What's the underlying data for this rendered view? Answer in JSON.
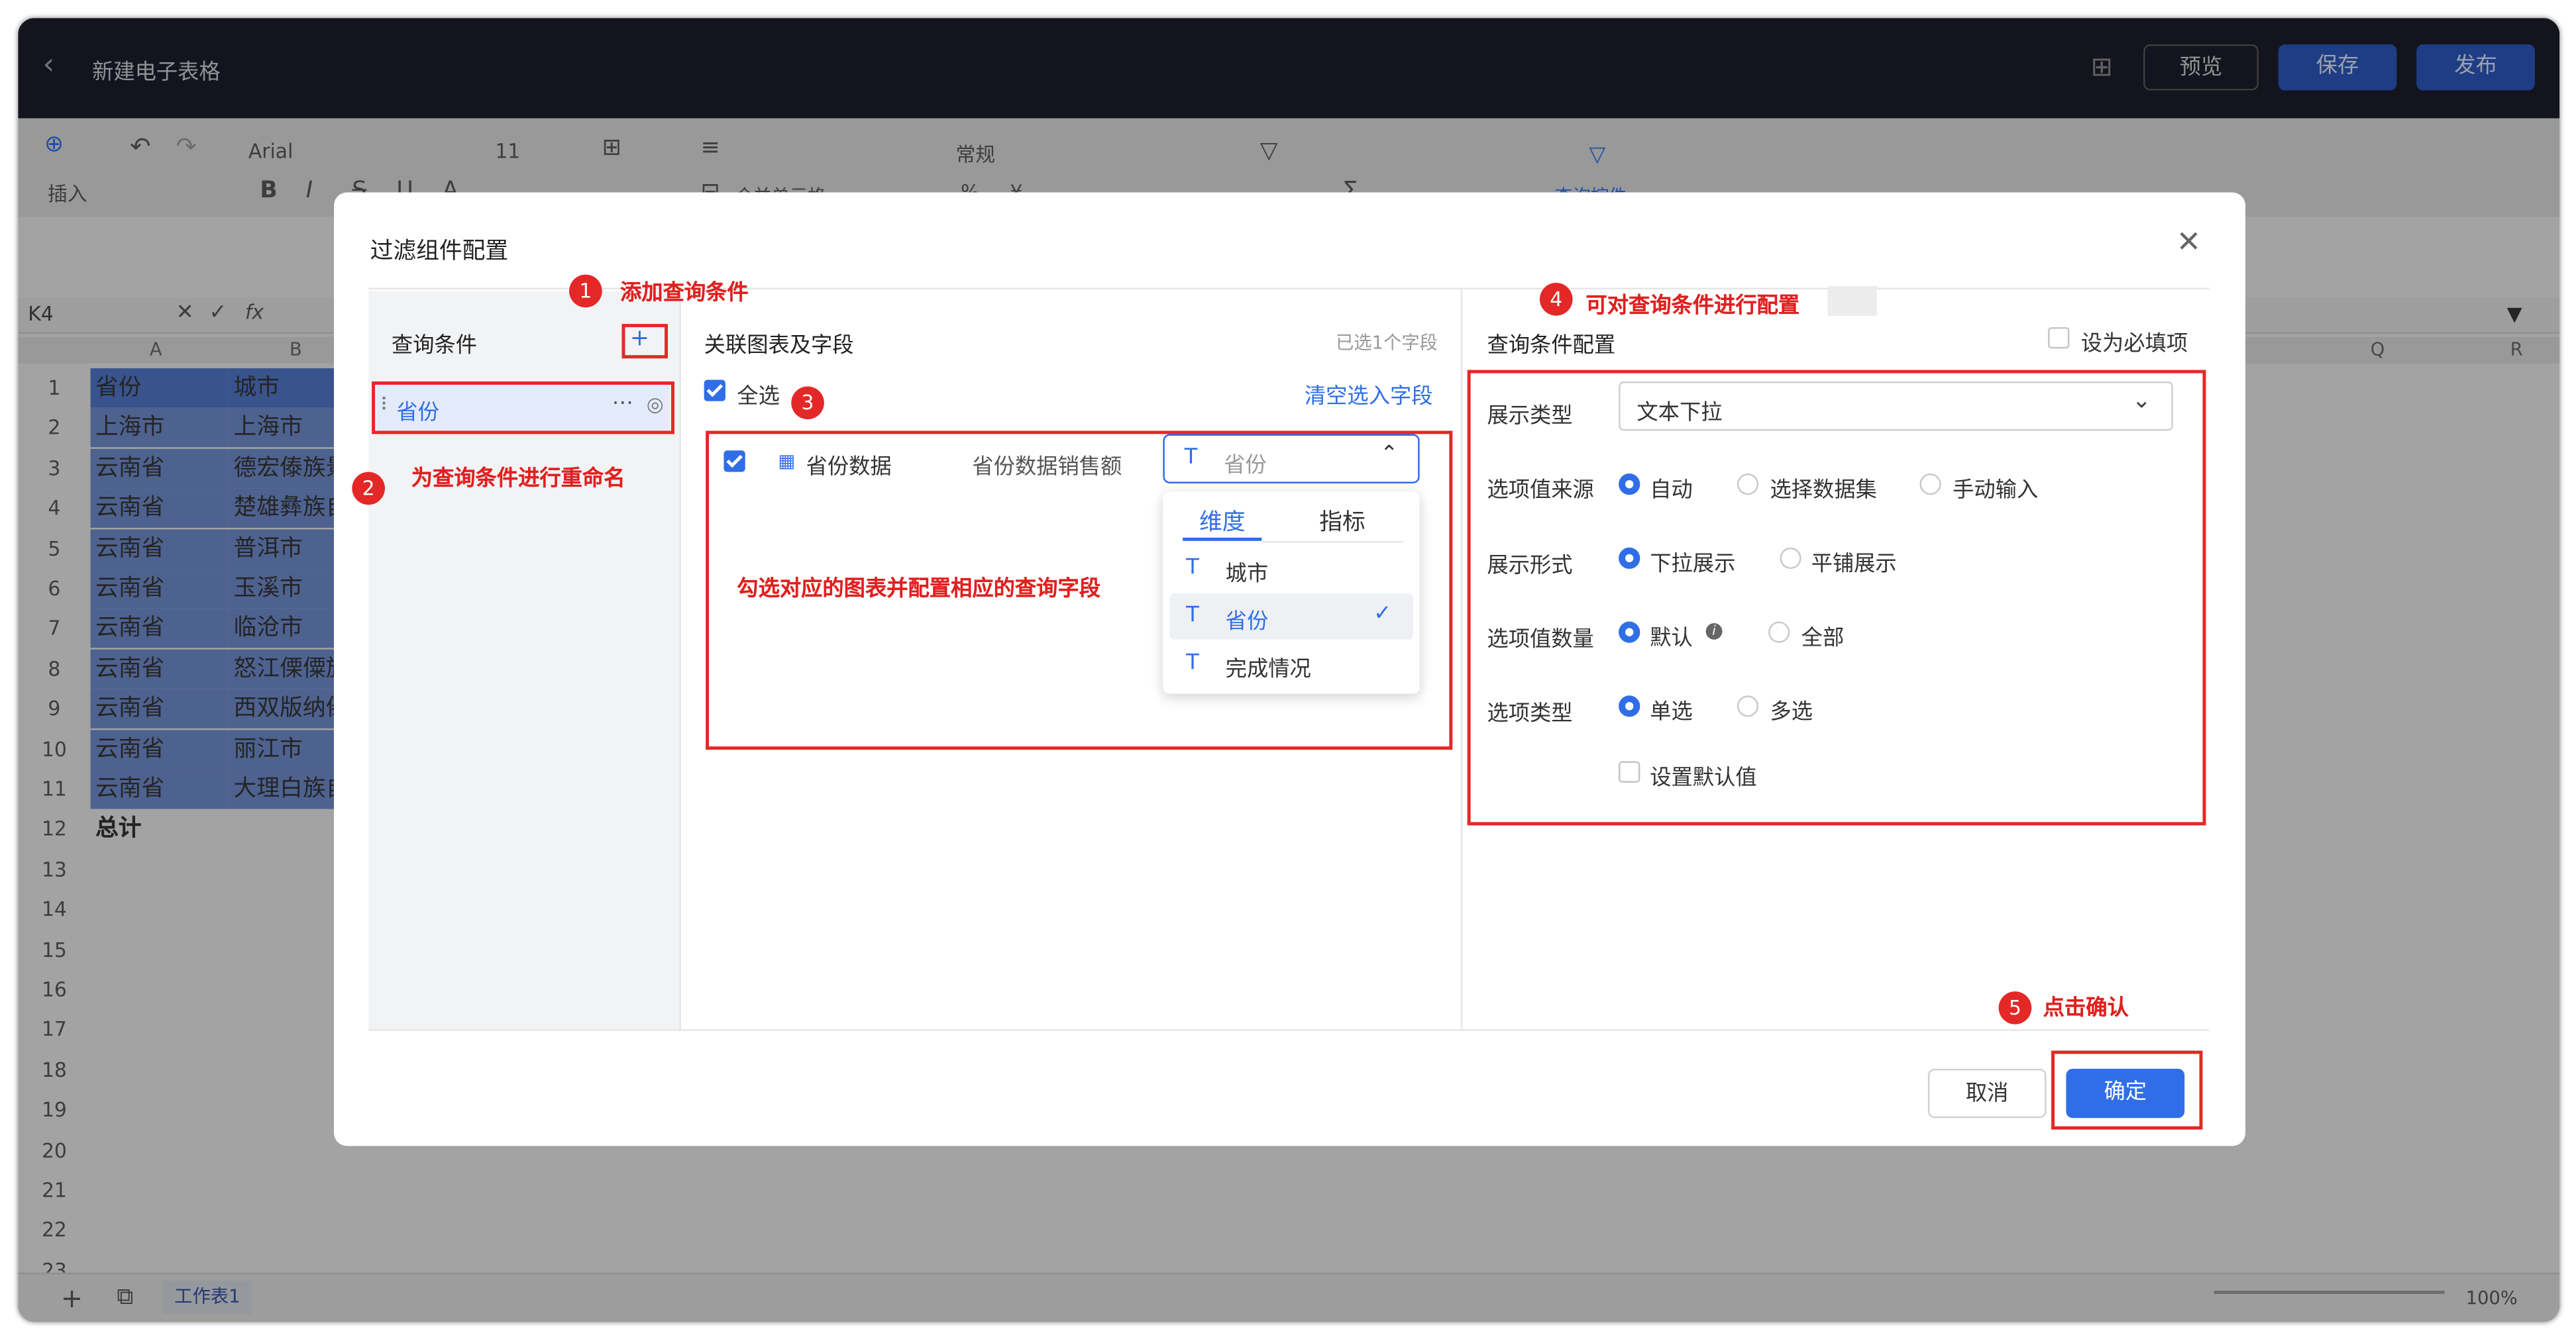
{
  "app": {
    "title": "新建电子表格",
    "preview": "预览",
    "save": "保存",
    "publish": "发布"
  },
  "toolbar": {
    "insert": "插入",
    "font": "Arial",
    "font_size": "11",
    "merge": "合并单元格",
    "number_format": "常规",
    "query_control": "查询控件"
  },
  "formula_bar": {
    "cell_ref": "K4",
    "fx": "fx"
  },
  "columns": [
    "A",
    "B",
    "Q",
    "R"
  ],
  "rows": [
    {
      "n": "1",
      "a": "省份",
      "b": "城市"
    },
    {
      "n": "2",
      "a": "上海市",
      "b": "上海市"
    },
    {
      "n": "3",
      "a": "云南省",
      "b": "德宏傣族景"
    },
    {
      "n": "4",
      "a": "云南省",
      "b": "楚雄彝族自"
    },
    {
      "n": "5",
      "a": "云南省",
      "b": "普洱市"
    },
    {
      "n": "6",
      "a": "云南省",
      "b": "玉溪市"
    },
    {
      "n": "7",
      "a": "云南省",
      "b": "临沧市"
    },
    {
      "n": "8",
      "a": "云南省",
      "b": "怒江傈僳族"
    },
    {
      "n": "9",
      "a": "云南省",
      "b": "西双版纳傣"
    },
    {
      "n": "10",
      "a": "云南省",
      "b": "丽江市"
    },
    {
      "n": "11",
      "a": "云南省",
      "b": "大理白族自"
    },
    {
      "n": "12",
      "a": "总计",
      "b": ""
    },
    {
      "n": "13",
      "a": "",
      "b": ""
    },
    {
      "n": "14",
      "a": "",
      "b": ""
    },
    {
      "n": "15",
      "a": "",
      "b": ""
    },
    {
      "n": "16",
      "a": "",
      "b": ""
    },
    {
      "n": "17",
      "a": "",
      "b": ""
    },
    {
      "n": "18",
      "a": "",
      "b": ""
    },
    {
      "n": "19",
      "a": "",
      "b": ""
    },
    {
      "n": "20",
      "a": "",
      "b": ""
    },
    {
      "n": "21",
      "a": "",
      "b": ""
    },
    {
      "n": "22",
      "a": "",
      "b": ""
    },
    {
      "n": "23",
      "a": "",
      "b": ""
    }
  ],
  "sheet_tab": "工作表1",
  "zoom": "100%",
  "dialog": {
    "title": "过滤组件配置",
    "left": {
      "header": "查询条件",
      "add": "+",
      "item": "省份"
    },
    "middle": {
      "header": "关联图表及字段",
      "selected_count": "已选1个字段",
      "select_all": "全选",
      "clear": "清空选入字段",
      "chart_name": "省份数据",
      "chart_field": "省份数据销售额",
      "field_placeholder": "省份",
      "tab_dimension": "维度",
      "tab_metric": "指标",
      "options": [
        "城市",
        "省份",
        "完成情况"
      ]
    },
    "right": {
      "header": "查询条件配置",
      "required": "设为必填项",
      "display_type_label": "展示类型",
      "display_type_value": "文本下拉",
      "source_label": "选项值来源",
      "source_options": [
        "自动",
        "选择数据集",
        "手动输入"
      ],
      "form_label": "展示形式",
      "form_options": [
        "下拉展示",
        "平铺展示"
      ],
      "count_label": "选项值数量",
      "count_options": [
        "默认",
        "全部"
      ],
      "select_label": "选项类型",
      "select_options": [
        "单选",
        "多选"
      ],
      "default_value": "设置默认值"
    },
    "cancel": "取消",
    "confirm": "确定"
  },
  "annotations": [
    {
      "n": "1",
      "text": "添加查询条件"
    },
    {
      "n": "2",
      "text": "为查询条件进行重命名"
    },
    {
      "n": "3",
      "text": "勾选对应的图表并配置相应的查询字段"
    },
    {
      "n": "4",
      "text": "可对查询条件进行配置"
    },
    {
      "n": "5",
      "text": "点击确认"
    }
  ],
  "colors": {
    "accent": "#2f6ee6",
    "annotation": "#e42828",
    "topbar": "#1b1d29"
  }
}
